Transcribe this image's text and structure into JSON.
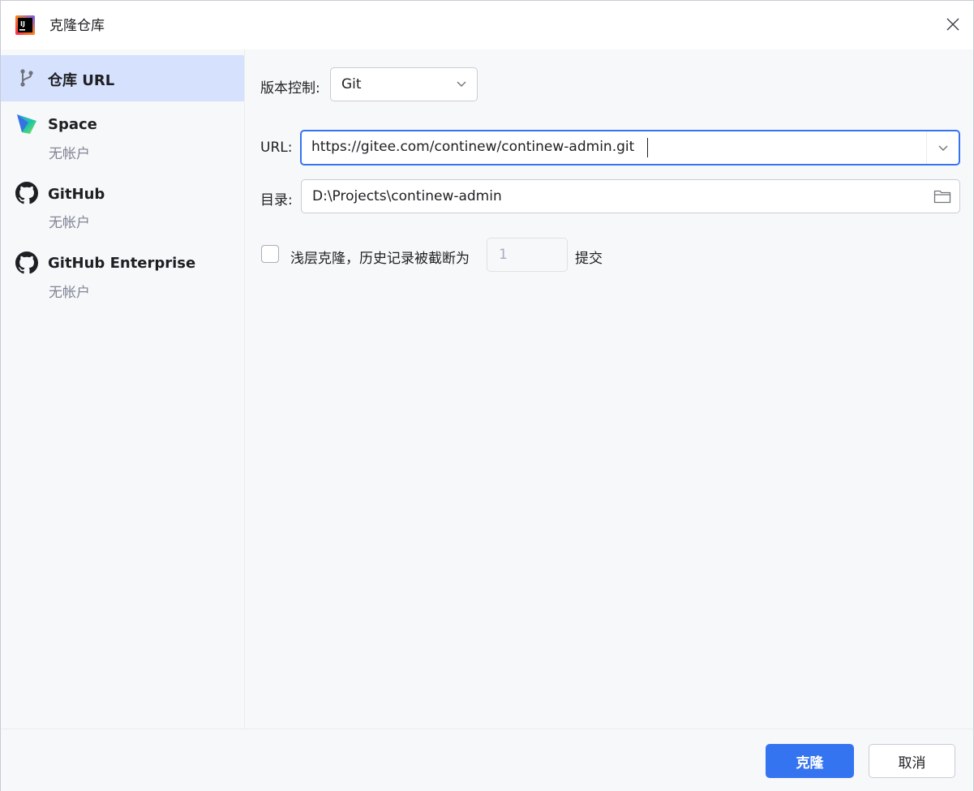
{
  "window": {
    "title": "克隆仓库",
    "logo_icon": "intellij-idea-icon",
    "close_icon": "close-icon"
  },
  "sidebar": {
    "items": [
      {
        "label": "仓库 URL",
        "icon": "vcs-branch-icon",
        "selected": true
      },
      {
        "label": "Space",
        "sub": "无帐户",
        "icon": "space-logo-icon"
      },
      {
        "label": "GitHub",
        "sub": "无帐户",
        "icon": "github-icon"
      },
      {
        "label": "GitHub Enterprise",
        "sub": "无帐户",
        "icon": "github-icon"
      }
    ]
  },
  "form": {
    "vcs_label": "版本控制:",
    "vcs_value": "Git",
    "url_label": "URL:",
    "url_value": "https://gitee.com/continew/continew-admin.git",
    "dir_label": "目录:",
    "dir_value": "D:\\Projects\\continew-admin",
    "shallow_label": "浅层克隆，历史记录被截断为",
    "shallow_checked": false,
    "depth_value": "1",
    "depth_suffix": "提交"
  },
  "footer": {
    "clone_label": "克隆",
    "cancel_label": "取消"
  },
  "colors": {
    "accent": "#3574f0",
    "selection": "#d5e1fd",
    "background": "#f7f8fa"
  }
}
